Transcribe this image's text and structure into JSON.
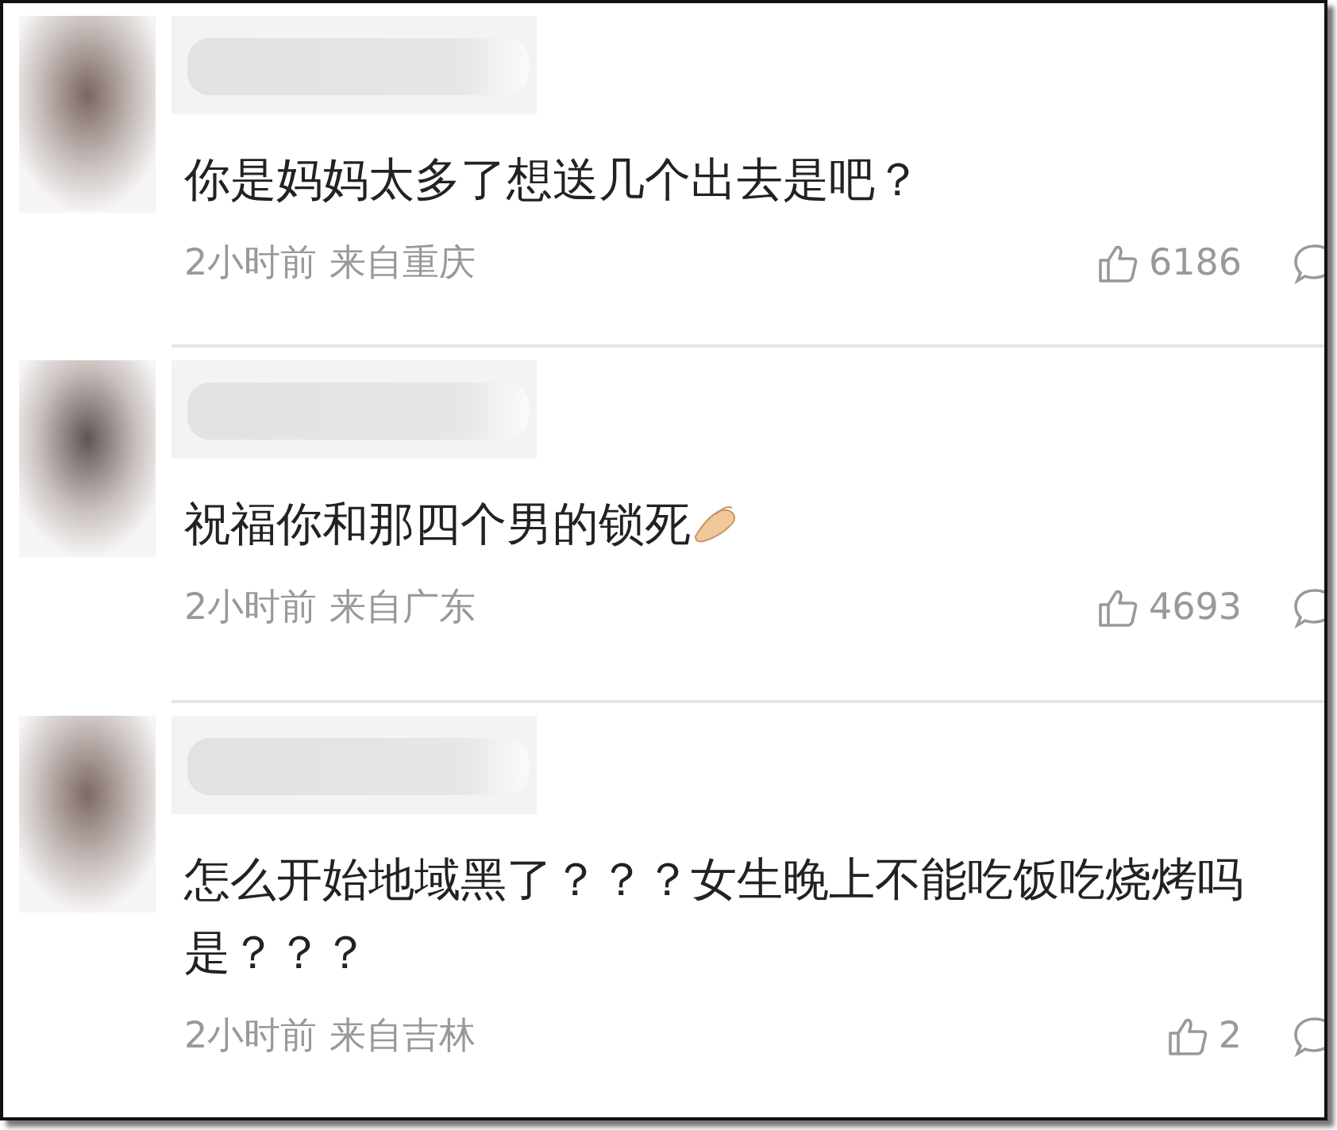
{
  "comments": [
    {
      "text": "你是妈妈太多了想送几个出去是吧？",
      "emoji": false,
      "time": "2小时前",
      "location": "来自重庆",
      "likes": "6186"
    },
    {
      "text": "祝福你和那四个男的锁死",
      "emoji": true,
      "time": "2小时前",
      "location": "来自广东",
      "likes": "4693"
    },
    {
      "text": "怎么开始地域黑了？？？女生晚上不能吃饭吃烧烤吗是？？？",
      "emoji": false,
      "time": "2小时前",
      "location": "来自吉林",
      "likes": "2"
    }
  ]
}
